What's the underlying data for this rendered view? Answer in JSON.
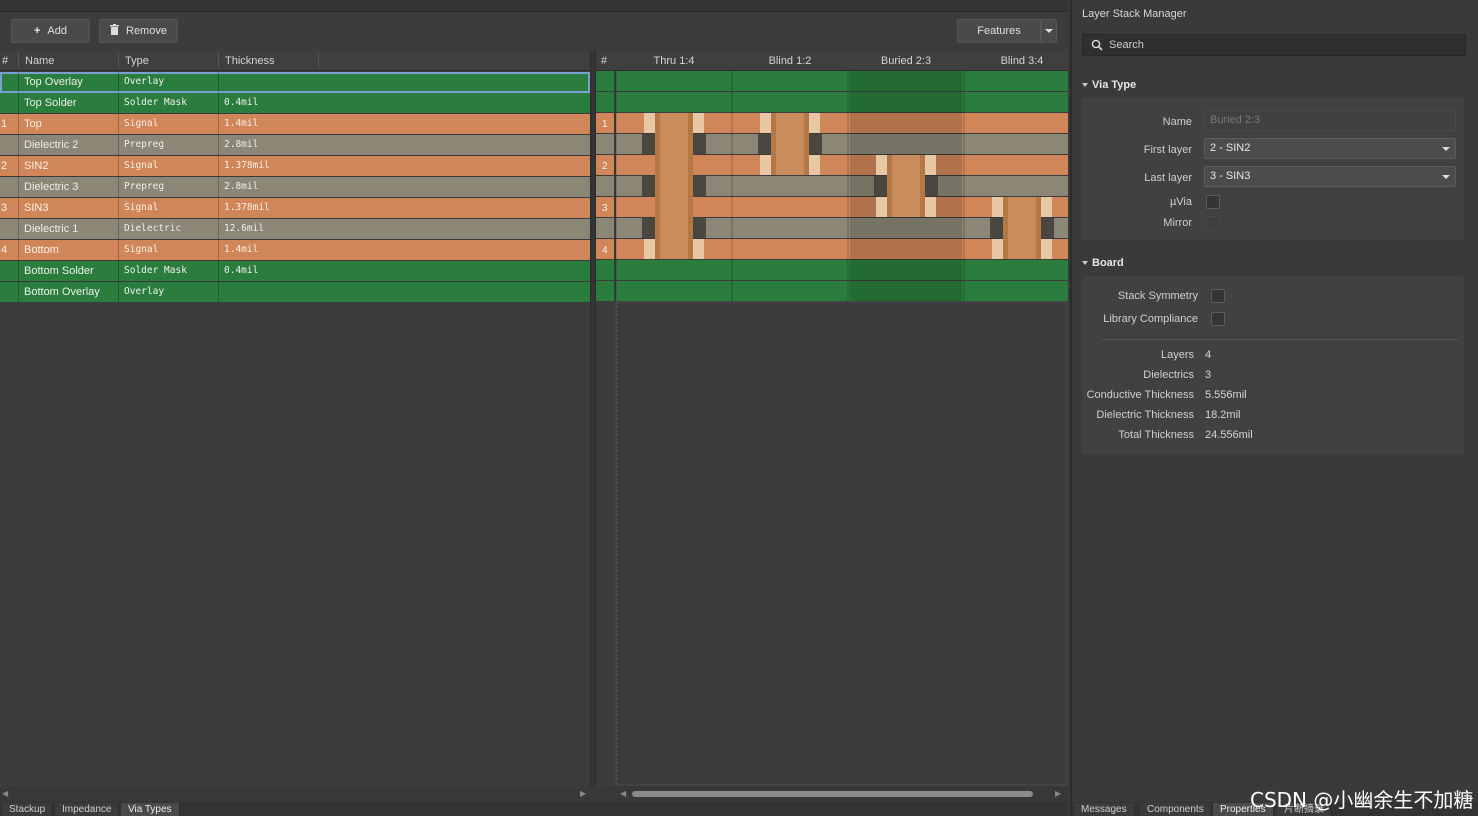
{
  "toolbar": {
    "add_label": "Add",
    "remove_label": "Remove",
    "features_label": "Features"
  },
  "grid": {
    "columns": [
      "#",
      "Name",
      "Type",
      "Thickness"
    ],
    "rows": [
      {
        "num": "",
        "name": "Top Overlay",
        "type": "Overlay",
        "thickness": "",
        "kind": "green"
      },
      {
        "num": "",
        "name": "Top Solder",
        "type": "Solder Mask",
        "thickness": "0.4mil",
        "kind": "green"
      },
      {
        "num": "1",
        "name": "Top",
        "type": "Signal",
        "thickness": "1.4mil",
        "kind": "orange"
      },
      {
        "num": "",
        "name": "Dielectric 2",
        "type": "Prepreg",
        "thickness": "2.8mil",
        "kind": "gray"
      },
      {
        "num": "2",
        "name": "SIN2",
        "type": "Signal",
        "thickness": "1.378mil",
        "kind": "orange"
      },
      {
        "num": "",
        "name": "Dielectric 3",
        "type": "Prepreg",
        "thickness": "2.8mil",
        "kind": "gray"
      },
      {
        "num": "3",
        "name": "SIN3",
        "type": "Signal",
        "thickness": "1.378mil",
        "kind": "orange"
      },
      {
        "num": "",
        "name": "Dielectric 1",
        "type": "Dielectric",
        "thickness": "12.6mil",
        "kind": "gray"
      },
      {
        "num": "4",
        "name": "Bottom",
        "type": "Signal",
        "thickness": "1.4mil",
        "kind": "orange"
      },
      {
        "num": "",
        "name": "Bottom Solder",
        "type": "Solder Mask",
        "thickness": "0.4mil",
        "kind": "green"
      },
      {
        "num": "",
        "name": "Bottom Overlay",
        "type": "Overlay",
        "thickness": "",
        "kind": "green"
      }
    ]
  },
  "viz": {
    "hash_label": "#",
    "via_columns": [
      "Thru 1:4",
      "Blind 1:2",
      "Buried 2:3",
      "Blind 3:4"
    ],
    "vias": [
      {
        "from": 1,
        "to": 4
      },
      {
        "from": 1,
        "to": 2
      },
      {
        "from": 2,
        "to": 3
      },
      {
        "from": 3,
        "to": 4
      }
    ],
    "selected_via": 2
  },
  "bottom_tabs": [
    "Stackup",
    "Impedance",
    "Via Types"
  ],
  "active_tab": "Via Types",
  "panel": {
    "title": "Layer Stack Manager",
    "search_placeholder": "Search",
    "via_type": {
      "title": "Via Type",
      "name_label": "Name",
      "name_value": "Buried 2:3",
      "first_layer_label": "First layer",
      "first_layer_value": "2 - SIN2",
      "last_layer_label": "Last layer",
      "last_layer_value": "3 - SIN3",
      "uvia_label": "µVia",
      "mirror_label": "Mirror"
    },
    "board": {
      "title": "Board",
      "stack_symmetry_label": "Stack Symmetry",
      "library_compliance_label": "Library Compliance",
      "stats": [
        {
          "label": "Layers",
          "value": "4"
        },
        {
          "label": "Dielectrics",
          "value": "3"
        },
        {
          "label": "Conductive Thickness",
          "value": "5.556mil"
        },
        {
          "label": "Dielectric Thickness",
          "value": "18.2mil"
        },
        {
          "label": "Total Thickness",
          "value": "24.556mil"
        }
      ]
    },
    "tabs": [
      "Messages",
      "Components",
      "Properties",
      "片断摘录"
    ]
  },
  "watermark": "CSDN @小幽余生不加糖",
  "colors": {
    "signal": "#d08659",
    "dielectric": "#8b8676",
    "mask": "#2b7d3d",
    "via": "#c98c5c",
    "via_pad": "#e8c8a4"
  }
}
